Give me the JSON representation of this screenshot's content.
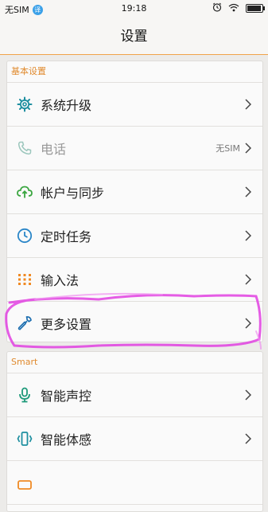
{
  "status_bar": {
    "carrier": "无SIM",
    "badge": "译",
    "time": "19:18",
    "battery_level": 0.92
  },
  "header": {
    "title": "设置"
  },
  "sections": [
    {
      "header": "基本设置",
      "items": [
        {
          "label": "系统升级",
          "icon": "gear-icon",
          "value": ""
        },
        {
          "label": "电话",
          "icon": "phone-icon",
          "value": "无SIM",
          "disabled": true
        },
        {
          "label": "帐户与同步",
          "icon": "cloud-sync-icon",
          "value": ""
        },
        {
          "label": "定时任务",
          "icon": "clock-icon",
          "value": ""
        },
        {
          "label": "输入法",
          "icon": "keyboard-icon",
          "value": ""
        },
        {
          "label": "更多设置",
          "icon": "wrench-icon",
          "value": ""
        }
      ]
    },
    {
      "header": "Smart",
      "items": [
        {
          "label": "智能声控",
          "icon": "microphone-icon",
          "value": ""
        },
        {
          "label": "智能体感",
          "icon": "motion-icon",
          "value": ""
        }
      ]
    }
  ],
  "colors": {
    "accent_orange": "#e08a2e",
    "icon_teal": "#1e8fa0",
    "icon_green": "#3aa640",
    "icon_orange": "#f08a24",
    "highlight_pink": "#e040e0"
  }
}
